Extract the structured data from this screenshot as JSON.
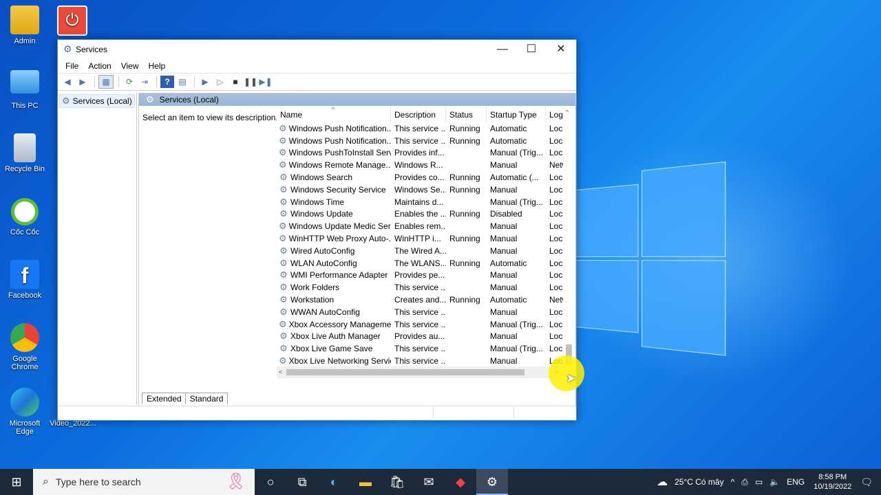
{
  "desktop": {
    "icons": [
      {
        "label": "Admin"
      },
      {
        "label": "This PC"
      },
      {
        "label": "Recycle Bin"
      },
      {
        "label": "Cốc Cốc"
      },
      {
        "label": "Facebook"
      },
      {
        "label": "Google Chrome"
      },
      {
        "label": "Microsoft Edge"
      },
      {
        "label": "Video_2022..."
      }
    ]
  },
  "window": {
    "title": "Services",
    "menu": [
      "File",
      "Action",
      "View",
      "Help"
    ],
    "tree_item": "Services (Local)",
    "pane_title": "Services (Local)",
    "description_hint": "Select an item to view its description.",
    "columns": [
      "Name",
      "Description",
      "Status",
      "Startup Type",
      "Log"
    ],
    "rows": [
      [
        "Windows Push Notification...",
        "This service ...",
        "Running",
        "Automatic",
        "Loca"
      ],
      [
        "Windows Push Notification...",
        "This service ...",
        "Running",
        "Automatic",
        "Loca"
      ],
      [
        "Windows PushToInstall Serv...",
        "Provides inf...",
        "",
        "Manual (Trig...",
        "Loca"
      ],
      [
        "Windows Remote Manage...",
        "Windows R...",
        "",
        "Manual",
        "Netw"
      ],
      [
        "Windows Search",
        "Provides co...",
        "Running",
        "Automatic (...",
        "Loca"
      ],
      [
        "Windows Security Service",
        "Windows Se...",
        "Running",
        "Manual",
        "Loca"
      ],
      [
        "Windows Time",
        "Maintains d...",
        "",
        "Manual (Trig...",
        "Loca"
      ],
      [
        "Windows Update",
        "Enables the ...",
        "Running",
        "Disabled",
        "Loca"
      ],
      [
        "Windows Update Medic Ser...",
        "Enables rem...",
        "",
        "Manual",
        "Loca"
      ],
      [
        "WinHTTP Web Proxy Auto-...",
        "WinHTTP i...",
        "Running",
        "Manual",
        "Loca"
      ],
      [
        "Wired AutoConfig",
        "The Wired A...",
        "",
        "Manual",
        "Loca"
      ],
      [
        "WLAN AutoConfig",
        "The WLANS...",
        "Running",
        "Automatic",
        "Loca"
      ],
      [
        "WMI Performance Adapter",
        "Provides pe...",
        "",
        "Manual",
        "Loca"
      ],
      [
        "Work Folders",
        "This service ...",
        "",
        "Manual",
        "Loca"
      ],
      [
        "Workstation",
        "Creates and...",
        "Running",
        "Automatic",
        "Netw"
      ],
      [
        "WWAN AutoConfig",
        "This service ...",
        "",
        "Manual",
        "Loca"
      ],
      [
        "Xbox Accessory Manageme...",
        "This service ...",
        "",
        "Manual (Trig...",
        "Loca"
      ],
      [
        "Xbox Live Auth Manager",
        "Provides au...",
        "",
        "Manual",
        "Loca"
      ],
      [
        "Xbox Live Game Save",
        "This service ...",
        "",
        "Manual (Trig...",
        "Loca"
      ],
      [
        "Xbox Live Networking Service",
        "This service ...",
        "",
        "Manual",
        "Loca"
      ]
    ],
    "tabs": [
      "Extended",
      "Standard"
    ]
  },
  "taskbar": {
    "search_placeholder": "Type here to search",
    "weather": "25°C  Có mây",
    "language": "ENG",
    "time": "8:58 PM",
    "date": "10/19/2022"
  },
  "colors": {
    "desktop": "#0b6ee0",
    "taskbar": "#1d2a3a",
    "cursor_highlight": "#fff000"
  }
}
